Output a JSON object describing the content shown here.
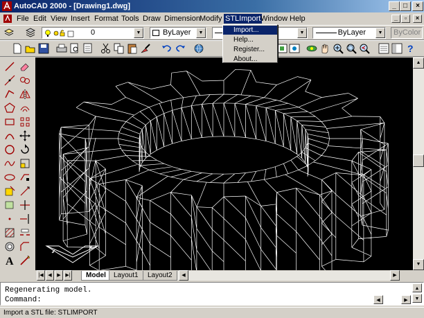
{
  "window": {
    "title": "AutoCAD 2000 - [Drawing1.dwg]"
  },
  "menubar": {
    "items": [
      "File",
      "Edit",
      "View",
      "Insert",
      "Format",
      "Tools",
      "Draw",
      "Dimension",
      "Modify",
      "STLImport",
      "Window",
      "Help"
    ],
    "active": "STLImport"
  },
  "dropdown": {
    "items": [
      "Import...",
      "Help...",
      "Register...",
      "About..."
    ],
    "highlighted": "Import..."
  },
  "properties_toolbar": {
    "layer_value": "0",
    "color_value": "ByLayer",
    "lineweight_value": "ByLayer",
    "plotstyle_value": "ByColor"
  },
  "layout_tabs": {
    "items": [
      "Model",
      "Layout1",
      "Layout2"
    ],
    "active": "Model"
  },
  "command": {
    "history": "Regenerating model.",
    "prompt": "Command:"
  },
  "status": "Import a STL file: STLIMPORT",
  "colors": {
    "title_start": "#0a246a",
    "title_end": "#a6caf0",
    "canvas_bg": "#000000",
    "wire": "#ffffff",
    "face": "#d4d0c8"
  }
}
